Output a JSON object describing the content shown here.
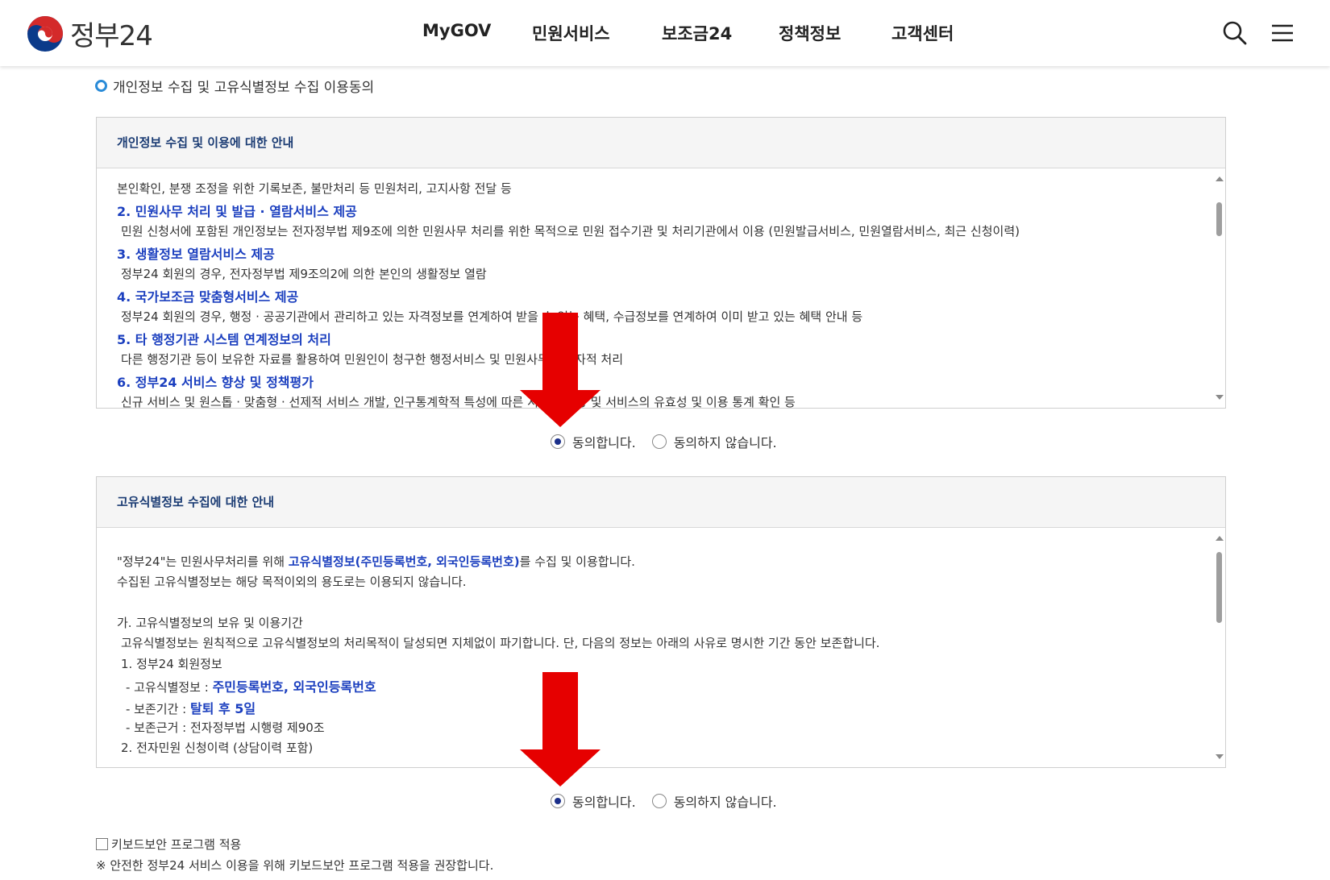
{
  "header": {
    "logo_text": "정부24",
    "nav": [
      "MyGOV",
      "민원서비스",
      "보조금24",
      "정책정보",
      "고객센터"
    ],
    "icons": [
      "search-icon",
      "menu-icon"
    ]
  },
  "section_title": "개인정보 수집 및 고유식별정보 수집 이용동의",
  "box1": {
    "heading": "개인정보 수집 및 이용에 대한 안내",
    "lines": [
      "본인확인, 분쟁 조정을 위한 기록보존, 불만처리 등 민원처리, 고지사항 전달 등",
      "2. 민원사무 처리 및 발급 · 열람서비스 제공",
      "민원 신청서에 포함된 개인정보는 전자정부법 제9조에 의한 민원사무 처리를 위한 목적으로 민원 접수기관 및 처리기관에서 이용 (민원발급서비스, 민원열람서비스, 최근 신청이력)",
      "3. 생활정보 열람서비스 제공",
      "정부24 회원의 경우, 전자정부법 제9조의2에 의한 본인의 생활정보 열람",
      "4. 국가보조금 맞춤형서비스 제공",
      "정부24 회원의 경우, 행정 · 공공기관에서 관리하고 있는 자격정보를 연계하여 받을 수 있는 혜택, 수급정보를 연계하여 이미 받고 있는 혜택 안내 등",
      "5. 타 행정기관 시스템 연계정보의 처리",
      "다른 행정기관 등이 보유한 자료를 활용하여 민원인이 청구한 행정서비스 및 민원사무의 전자적 처리",
      "6. 정부24 서비스 향상 및 정책평가",
      "신규 서비스 및 원스톱 · 맞춤형 · 선제적 서비스 개발, 인구통계학적 특성에 따른 서비스 제공 및 서비스의 유효성 및 이용 통계 확인 등"
    ],
    "agree": "동의합니다.",
    "disagree": "동의하지 않습니다.",
    "selected": "agree"
  },
  "box2": {
    "heading": "고유식별정보 수집에 대한 안내",
    "p1_pre": "\"정부24\"는 민원사무처리를 위해 ",
    "p1_hl": "고유식별정보(주민등록번호, 외국인등록번호)",
    "p1_post": "를 수집 및 이용합니다.",
    "p2": "수집된 고유식별정보는 해당 목적이외의 용도로는 이용되지 않습니다.",
    "s_title": "가. 고유식별정보의 보유 및 이용기간",
    "s_desc": "고유식별정보는 원칙적으로 고유식별정보의 처리목적이 달성되면 지체없이 파기합니다. 단, 다음의 정보는 아래의 사유로 명시한 기간 동안 보존합니다.",
    "item1": "1. 정부24 회원정보",
    "i1a_label": "- 고유식별정보 : ",
    "i1a_val": "주민등록번호, 외국인등록번호",
    "i1b_label": "- 보존기간 : ",
    "i1b_val": "탈퇴 후 5일",
    "i1c": "- 보존근거 : 전자정부법 시행령 제90조",
    "item2": "2. 전자민원 신청이력 (상담이력 포함)",
    "agree": "동의합니다.",
    "disagree": "동의하지 않습니다.",
    "selected": "agree"
  },
  "keyboard_security": {
    "label": "키보드보안 프로그램 적용",
    "checked": false,
    "note": "※ 안전한 정부24 서비스 이용을 위해 키보드보안 프로그램 적용을 권장합니다."
  },
  "colors": {
    "accent_blue": "#1b3fbf",
    "heading_navy": "#1a3b73",
    "annotation_red": "#e60000"
  }
}
